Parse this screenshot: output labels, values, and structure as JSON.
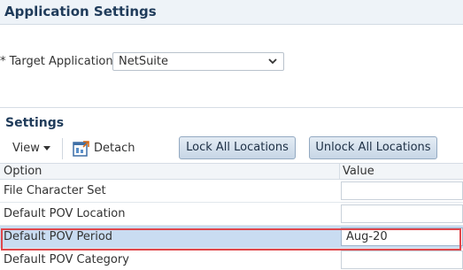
{
  "header": {
    "title": "Application Settings"
  },
  "target": {
    "label": "* Target Application",
    "selected": "NetSuite"
  },
  "settings": {
    "title": "Settings",
    "toolbar": {
      "view_label": "View",
      "detach_label": "Detach",
      "lock_all_label": "Lock All Locations",
      "unlock_all_label": "Unlock All Locations"
    },
    "columns": {
      "option": "Option",
      "value": "Value"
    },
    "rows": [
      {
        "option": "File Character Set",
        "value": ""
      },
      {
        "option": "Default POV Location",
        "value": ""
      },
      {
        "option": "Default POV Period",
        "value": "Aug-20"
      },
      {
        "option": "Default POV Category",
        "value": ""
      }
    ]
  },
  "colors": {
    "highlight": "#e0474c",
    "selected_row": "#c9dcf1",
    "header_bg": "#eef3f8"
  },
  "icons": [
    "chevron-down-icon",
    "caret-down-icon",
    "detach-icon"
  ]
}
